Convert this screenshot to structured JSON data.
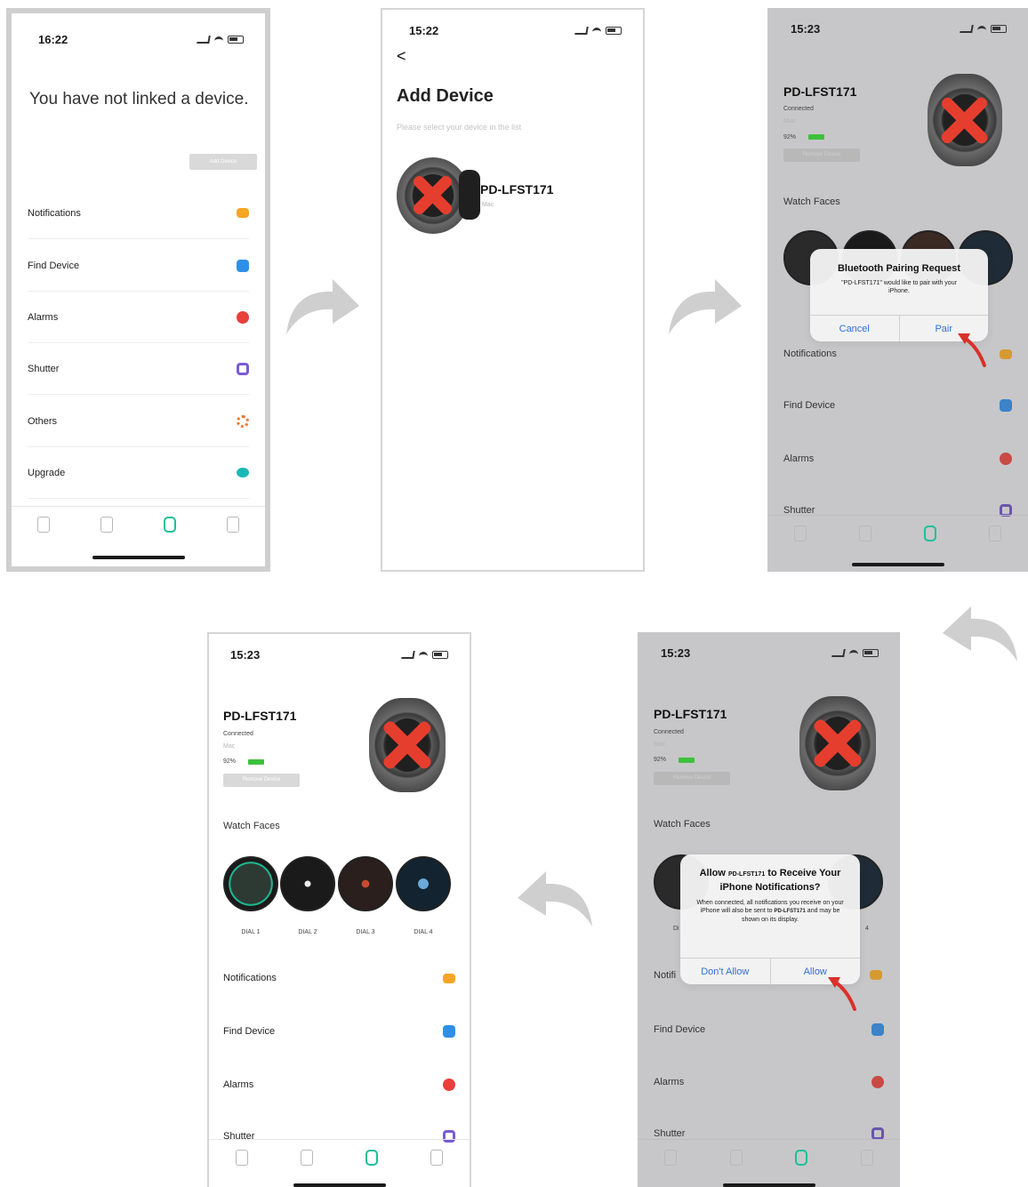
{
  "screens": {
    "no_device": {
      "time": "16:22",
      "headline": "You have not linked a device.",
      "add_button": "Add Device",
      "menu": [
        {
          "label": "Notifications",
          "icon": "message-icon",
          "color": "#f5a623"
        },
        {
          "label": "Find Device",
          "icon": "find-device-icon",
          "color": "#2f8fe8"
        },
        {
          "label": "Alarms",
          "icon": "alarm-icon",
          "color": "#e8403a"
        },
        {
          "label": "Shutter",
          "icon": "camera-icon",
          "color": "#7a5ad6"
        },
        {
          "label": "Others",
          "icon": "gear-icon",
          "color": "#f07a2e"
        },
        {
          "label": "Upgrade",
          "icon": "upload-icon",
          "color": "#1ab8b8"
        }
      ]
    },
    "add_device": {
      "time": "15:22",
      "back": "<",
      "title": "Add Device",
      "subtitle": "Please select your device in the list",
      "device_name": "PD-LFST171",
      "device_mac": "Mac"
    },
    "pair": {
      "time": "15:23",
      "device_name": "PD-LFST171",
      "status": "Connected",
      "mac": "Mac",
      "battery": "92%",
      "unbind": "Remove Device",
      "watch_faces": "Watch Faces",
      "alert_title": "Bluetooth Pairing Request",
      "alert_msg": "\"PD-LFST171\" would like to pair with your iPhone.",
      "cancel": "Cancel",
      "confirm": "Pair",
      "menu": [
        "Notifications",
        "Find Device",
        "Alarms",
        "Shutter"
      ]
    },
    "notify": {
      "time": "15:23",
      "device_name": "PD-LFST171",
      "status": "Connected",
      "mac": "Mac",
      "battery": "92%",
      "unbind": "Remove Device",
      "watch_faces": "Watch Faces",
      "alert_title_1": "Allow",
      "alert_title_dev": "PD-LFST171",
      "alert_title_2": "to Receive Your iPhone Notifications?",
      "alert_msg_1": "When connected, all notifications you receive on your iPhone will also be sent to",
      "alert_msg_dev": "PD-LFST171",
      "alert_msg_2": "and may be shown on its display.",
      "deny": "Don't Allow",
      "allow": "Allow",
      "dial_fragment_left": "Di",
      "dial_fragment_right": "4",
      "notif_fragment": "Notifi",
      "menu": [
        "Find Device",
        "Alarms",
        "Shutter"
      ]
    },
    "final": {
      "time": "15:23",
      "device_name": "PD-LFST171",
      "status": "Connected",
      "mac": "Mac",
      "battery": "92%",
      "unbind": "Remove Device",
      "watch_faces": "Watch Faces",
      "dials": [
        "DIAL 1",
        "DIAL 2",
        "DIAL 3",
        "DIAL 4"
      ],
      "menu": [
        "Notifications",
        "Find Device",
        "Alarms",
        "Shutter"
      ]
    }
  },
  "colors": {
    "accent": "#1bbf9a",
    "alert_button": "#2f6fd6",
    "pointer_arrow": "#d9312a",
    "flow_arrow": "#cfcfcf"
  }
}
